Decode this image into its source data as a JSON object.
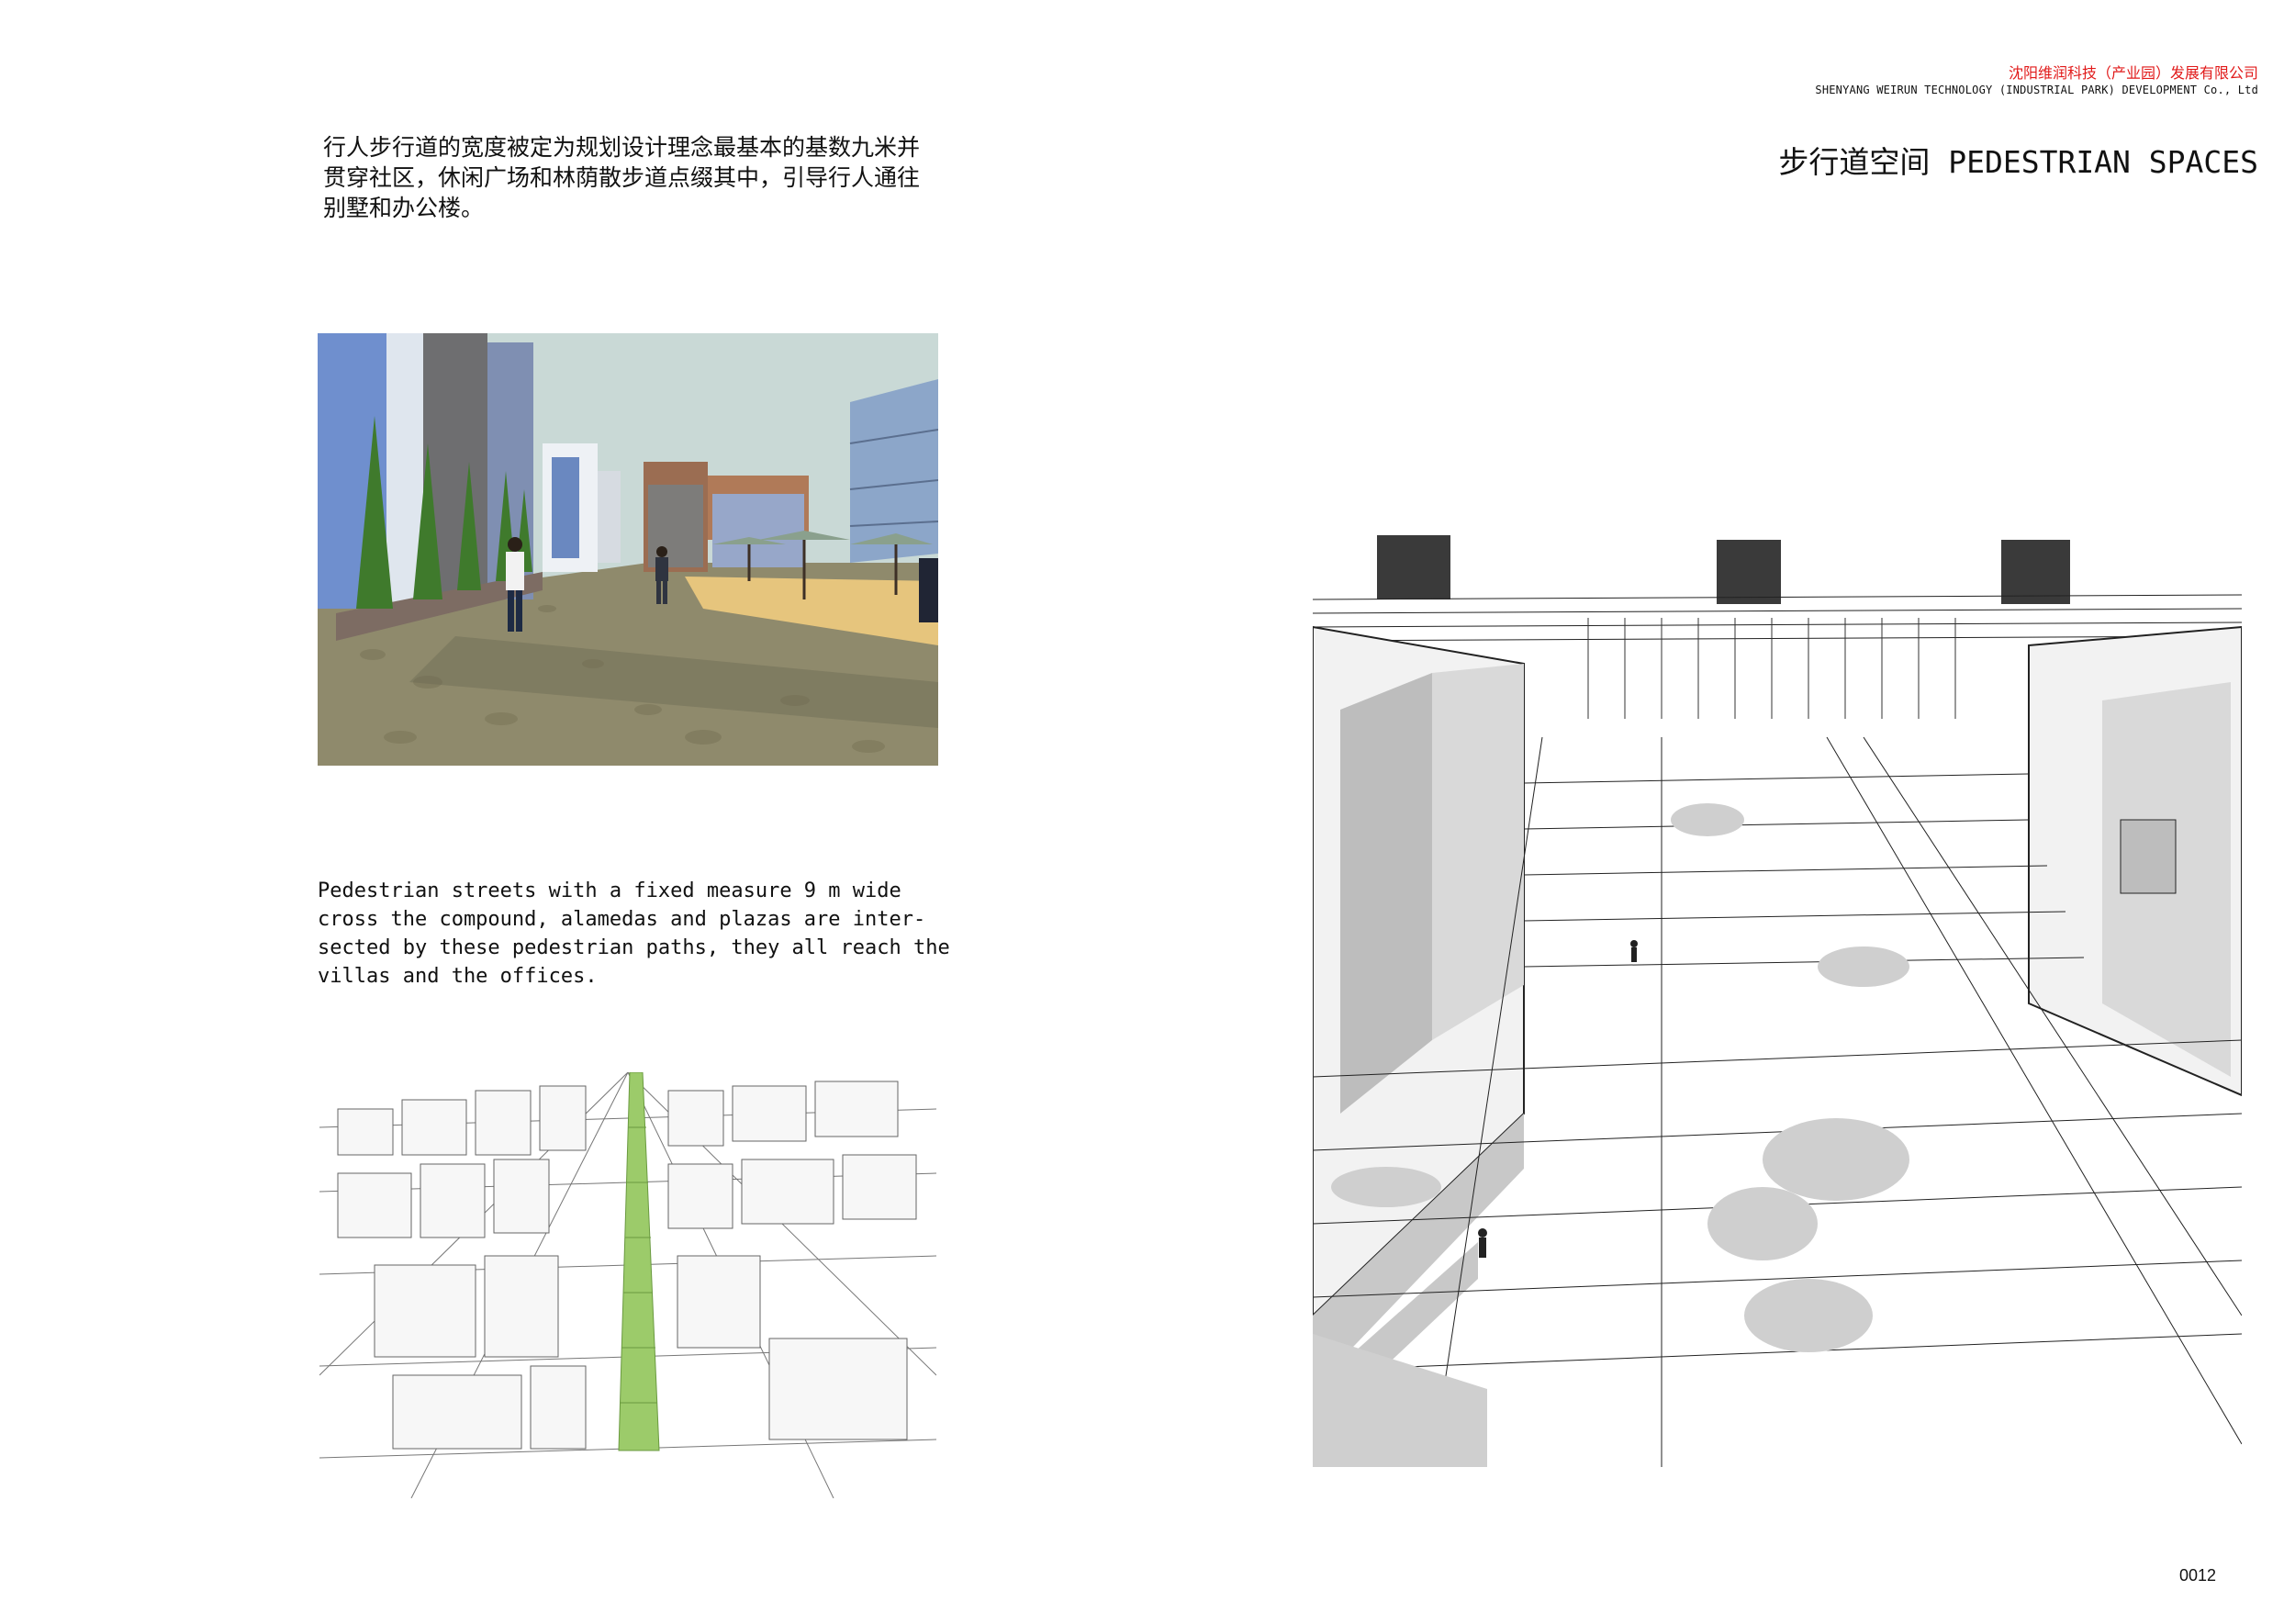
{
  "header": {
    "company_cn": "沈阳维润科技（产业园）发展有限公司",
    "company_en": "SHENYANG WEIRUN TECHNOLOGY (INDUSTRIAL PARK) DEVELOPMENT Co., Ltd",
    "section_title": "步行道空间 PEDESTRIAN SPACES"
  },
  "intro": {
    "cn": "行人步行道的宽度被定为规划设计理念最基本的基数九米并贯穿社区，休闲广场和林荫散步道点缀其中，引导行人通往别墅和办公楼。",
    "en": "Pedestrian streets with a fixed measure 9 m wide\ncross the compound, alamedas and plazas are inter-\nsected by these pedestrian paths, they all reach the\nvillas and the offices."
  },
  "figures": {
    "street_view": "street-perspective-render",
    "aerial_plan": "aerial-line-drawing",
    "large_sketch": "pedestrian-street-sketch"
  },
  "colors": {
    "accent_red": "#e11a1a",
    "path_green": "#9ccb6a",
    "sky": "#c9d9d6",
    "paving": "#8f8a6c"
  },
  "footer": {
    "page_number": "0012"
  }
}
